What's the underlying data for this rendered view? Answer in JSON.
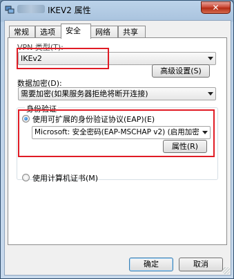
{
  "window": {
    "title": "IKEV2 属性",
    "close_label": "✕"
  },
  "tabs": [
    {
      "label": "常规",
      "active": false
    },
    {
      "label": "选项",
      "active": false
    },
    {
      "label": "安全",
      "active": true
    },
    {
      "label": "网络",
      "active": false
    },
    {
      "label": "共享",
      "active": false
    }
  ],
  "vpn": {
    "label": "VPN 类型(T):",
    "value": "IKEv2"
  },
  "advanced_button": "高级设置(S)",
  "encryption": {
    "label": "数据加密(D):",
    "value": "需要加密(如果服务器拒绝将断开连接)"
  },
  "auth": {
    "group_label": "身份验证",
    "eap_radio_label": "使用可扩展的身份验证协议(EAP)(E)",
    "eap_selected": true,
    "eap_method": "Microsoft: 安全密码(EAP-MSCHAP v2) (启用加密",
    "properties_button": "属性(R)",
    "cert_radio_label": "使用计算机证书(M)"
  },
  "footer": {
    "ok": "确定",
    "cancel": "取消"
  },
  "colors": {
    "highlight_box": "#e01b24",
    "title_bar": "#bcd3ea"
  }
}
